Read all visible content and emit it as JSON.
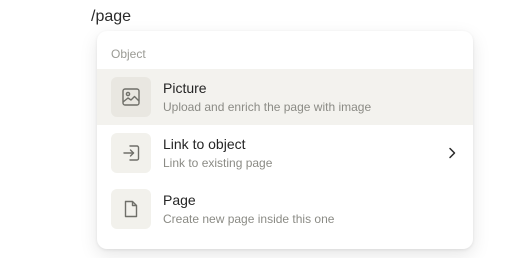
{
  "command": "/page",
  "menu": {
    "section_title": "Object",
    "items": [
      {
        "title": "Picture",
        "subtitle": "Upload and enrich the page with image",
        "icon": "picture-icon"
      },
      {
        "title": "Link to object",
        "subtitle": "Link to existing page",
        "icon": "link-icon"
      },
      {
        "title": "Page",
        "subtitle": "Create new page inside this one",
        "icon": "page-icon"
      }
    ]
  },
  "colors": {
    "selected_background": "#f3f2ee",
    "icon_background": "#f2f1ec",
    "secondary_text": "#8b8b85"
  }
}
